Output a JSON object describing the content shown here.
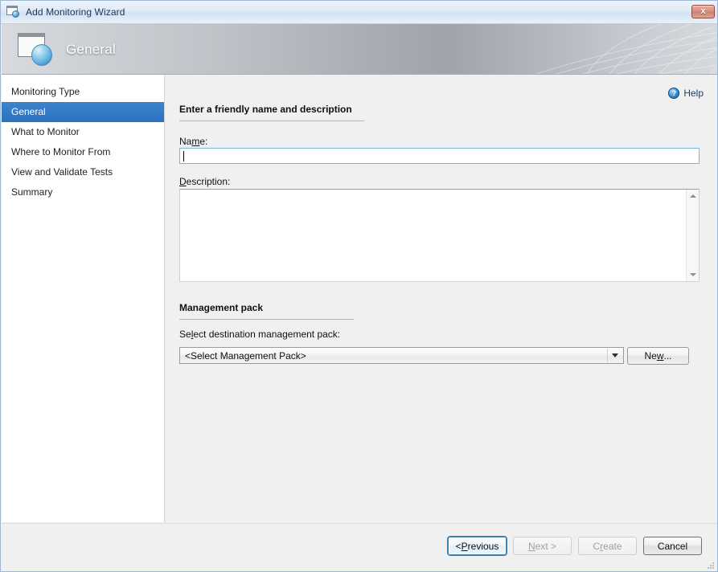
{
  "window": {
    "title": "Add Monitoring Wizard",
    "title_icon": "wizard-window-sphere-icon",
    "close_label": "x"
  },
  "banner": {
    "title": "General",
    "icon": "wizard-window-sphere-icon"
  },
  "sidebar": {
    "items": [
      {
        "label": "Monitoring Type",
        "selected": false
      },
      {
        "label": "General",
        "selected": true
      },
      {
        "label": "What to Monitor",
        "selected": false
      },
      {
        "label": "Where to Monitor From",
        "selected": false
      },
      {
        "label": "View and Validate Tests",
        "selected": false
      },
      {
        "label": "Summary",
        "selected": false
      }
    ]
  },
  "help": {
    "label": "Help",
    "icon": "help-question-icon"
  },
  "sections": {
    "general": {
      "heading": "Enter a friendly name and description",
      "name_label_before": "Na",
      "name_label_key": "m",
      "name_label_after": "e:",
      "name_value": "",
      "description_label_key": "D",
      "description_label_after": "escription:",
      "description_value": ""
    },
    "management_pack": {
      "heading": "Management pack",
      "select_label_before": "Se",
      "select_label_key": "l",
      "select_label_after": "ect destination management pack:",
      "combo_value": "<Select Management Pack>",
      "combo_arrow_icon": "chevron-down-icon",
      "new_label_before": "Ne",
      "new_label_key": "w",
      "new_label_after": "..."
    }
  },
  "footer": {
    "previous_before": "< ",
    "previous_key": "P",
    "previous_after": "revious",
    "next_key": "N",
    "next_after": "ext >",
    "create_before": "C",
    "create_key": "r",
    "create_after": "eate",
    "cancel_label": "Cancel"
  },
  "colors": {
    "accent": "#2a75c3",
    "banner_text": "#ffffff",
    "help_text": "#1a3f73",
    "close_button": "#cb7f6d"
  }
}
